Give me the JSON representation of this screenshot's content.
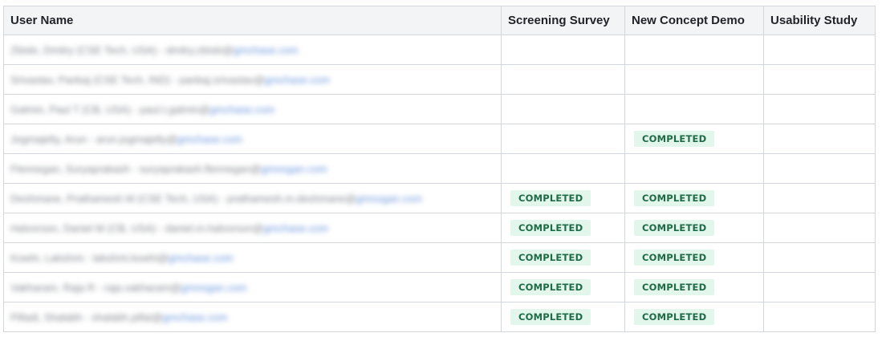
{
  "table": {
    "columns": [
      "User Name",
      "Screening Survey",
      "New Concept Demo",
      "Usability Study"
    ],
    "rows": [
      {
        "name": "Zbiski, Dmitry (CSE Tech, USA) - dmitry.zbiski@",
        "email": "gmchase.com",
        "screening": "",
        "concept": "",
        "usability": ""
      },
      {
        "name": "Srivastav, Pankaj (CSE Tech, IND) - pankaj.srivastav@",
        "email": "gmchase.com",
        "screening": "",
        "concept": "",
        "usability": ""
      },
      {
        "name": "Galmin, Paul T (CB, USA) - paul.t.galmin@",
        "email": "gmchase.com",
        "screening": "",
        "concept": "",
        "usability": ""
      },
      {
        "name": "Jogmajelty, Arun - arun.jogmajelty@",
        "email": "gmchase.com",
        "screening": "",
        "concept": "COMPLETED",
        "usability": ""
      },
      {
        "name": "Flennegan, Suryaprakash - suryaprakash.flennegan@",
        "email": "gmnogan.com",
        "screening": "",
        "concept": "",
        "usability": ""
      },
      {
        "name": "Deshmane, Prathamesh M (CSE Tech, USA) - prathamesh.m.deshmane@",
        "email": "gmnogan.com",
        "screening": "COMPLETED",
        "concept": "COMPLETED",
        "usability": ""
      },
      {
        "name": "Halvorson, Daniel M (CB, USA) - daniel.m.halvorson@",
        "email": "gmchase.com",
        "screening": "COMPLETED",
        "concept": "COMPLETED",
        "usability": ""
      },
      {
        "name": "Kowhi, Lakshmi - lakshmi.kowhi@",
        "email": "gmchase.com",
        "screening": "COMPLETED",
        "concept": "COMPLETED",
        "usability": ""
      },
      {
        "name": "Vakharam, Raja R - raja.vakharam@",
        "email": "gmnogan.com",
        "screening": "COMPLETED",
        "concept": "COMPLETED",
        "usability": ""
      },
      {
        "name": "Pilladi, Shalabh - shalabh.pillai@",
        "email": "gmchase.com",
        "screening": "COMPLETED",
        "concept": "COMPLETED",
        "usability": ""
      }
    ]
  },
  "colors": {
    "badge_bg": "#e3f6ec",
    "badge_text": "#1e6b45",
    "header_bg": "#f3f4f6",
    "border": "#d3d6db"
  }
}
